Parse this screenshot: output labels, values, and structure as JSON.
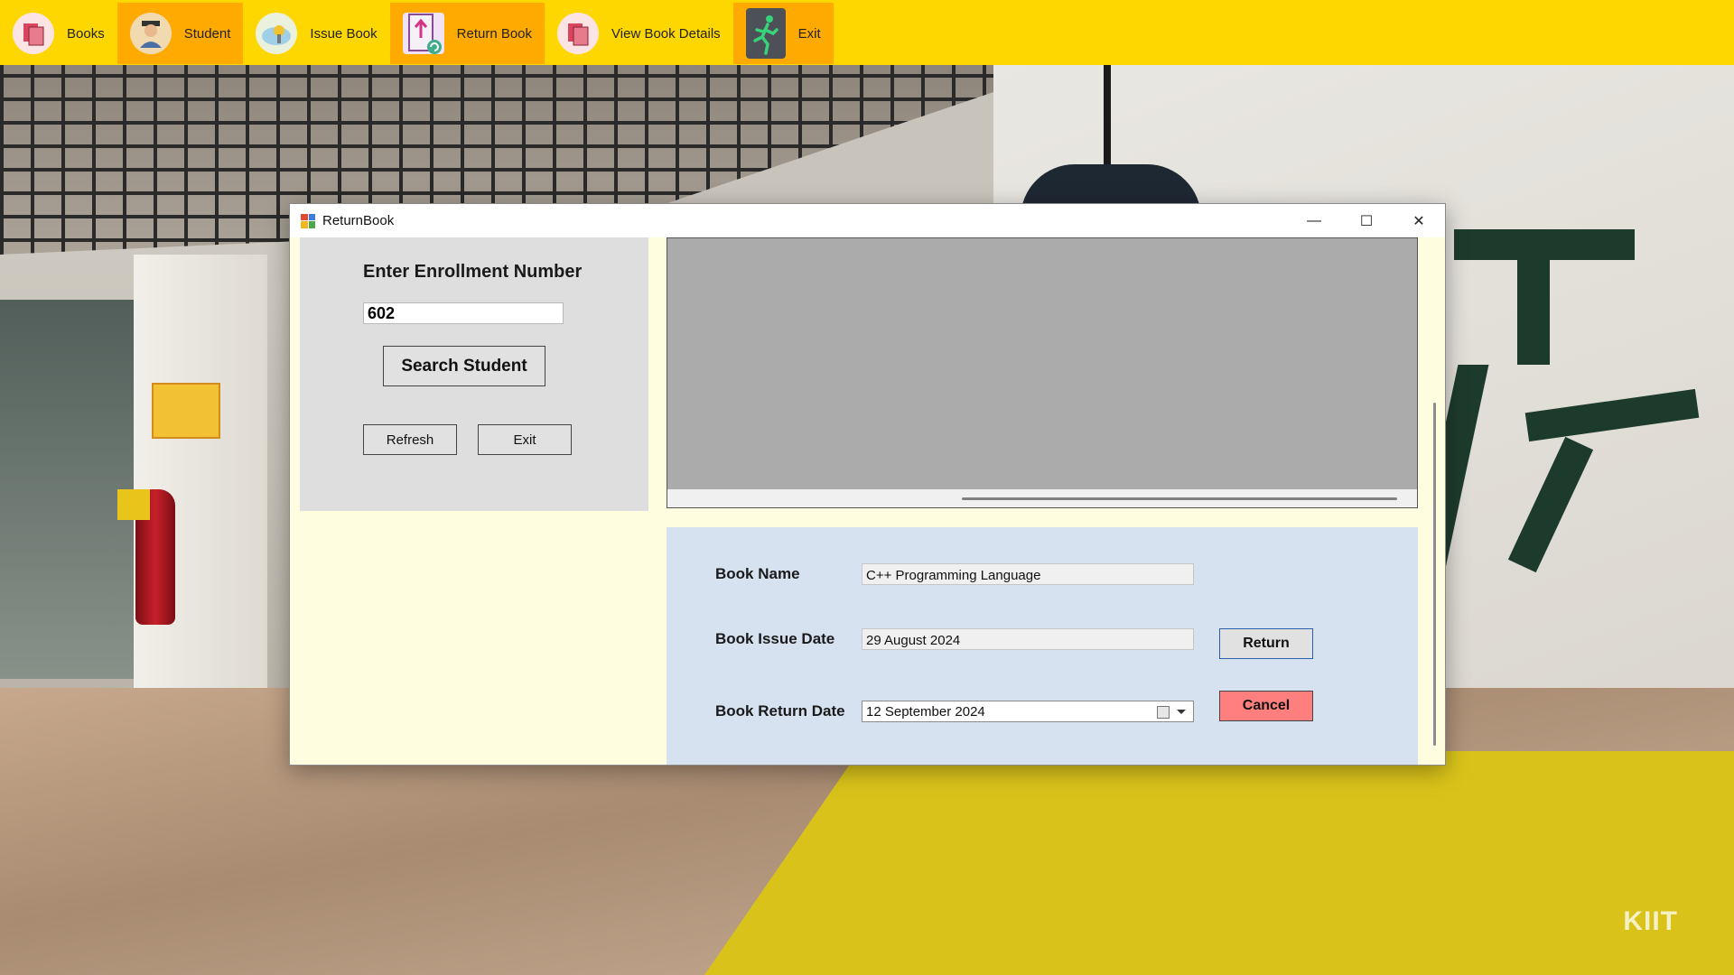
{
  "menu": {
    "items": [
      {
        "label": "Books",
        "icon": "books-icon",
        "active": false
      },
      {
        "label": "Student",
        "icon": "student-icon",
        "active": true
      },
      {
        "label": "Issue Book",
        "icon": "issue-book-icon",
        "active": false
      },
      {
        "label": "Return Book",
        "icon": "return-book-icon",
        "active": true
      },
      {
        "label": "View Book Details",
        "icon": "view-book-details-icon",
        "active": false
      },
      {
        "label": "Exit",
        "icon": "exit-running-icon",
        "active": true
      }
    ],
    "background_color": "#ffd700",
    "active_color": "#ffaa00"
  },
  "window": {
    "title": "ReturnBook",
    "controls": {
      "minimize": "—",
      "maximize": "☐",
      "close": "✕"
    }
  },
  "search": {
    "label": "Enter Enrollment Number",
    "enrollment_value": "602",
    "search_button": "Search Student",
    "refresh_button": "Refresh",
    "exit_button": "Exit"
  },
  "details": {
    "book_name_label": "Book Name",
    "book_name_value": "C++ Programming Language",
    "issue_date_label": "Book Issue Date",
    "issue_date_value": "29 August 2024",
    "return_date_label": "Book Return Date",
    "return_date_value": "12 September 2024",
    "return_button": "Return",
    "cancel_button": "Cancel",
    "cancel_color": "#ff7f7f",
    "panel_color": "#d7e2f0"
  },
  "background": {
    "watermark": "KIIT"
  }
}
